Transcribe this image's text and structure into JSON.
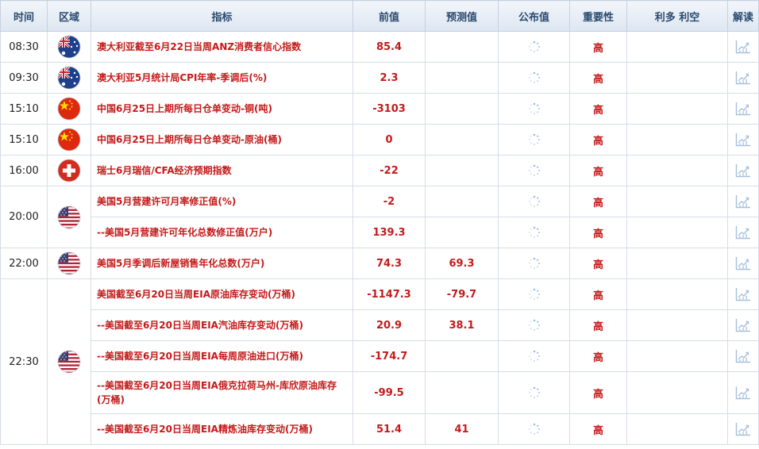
{
  "header": {
    "time": "时间",
    "region": "区域",
    "indicator": "指标",
    "previous": "前值",
    "forecast": "预测值",
    "actual": "公布值",
    "importance": "重要性",
    "impact": "利多 利空",
    "interpret": "解读"
  },
  "rows": {
    "r1": {
      "time": "08:30",
      "flag": "australia",
      "name": "澳大利亚截至6月22日当周ANZ消费者信心指数",
      "previous": "85.4",
      "forecast": "",
      "importance": "高"
    },
    "r2": {
      "time": "09:30",
      "flag": "australia",
      "name": "澳大利亚5月统计局CPI年率-季调后(%)",
      "previous": "2.3",
      "forecast": "",
      "importance": "高"
    },
    "r3": {
      "time": "15:10",
      "flag": "china",
      "name": "中国6月25日上期所每日仓单变动-铜(吨)",
      "previous": "-3103",
      "forecast": "",
      "importance": "高"
    },
    "r4": {
      "time": "15:10",
      "flag": "china",
      "name": "中国6月25日上期所每日仓单变动-原油(桶)",
      "previous": "0",
      "forecast": "",
      "importance": "高"
    },
    "r5": {
      "time": "16:00",
      "flag": "switzerland",
      "name": "瑞士6月瑞信/CFA经济预期指数",
      "previous": "-22",
      "forecast": "",
      "importance": "高"
    },
    "r6": {
      "time": "20:00",
      "flag": "usa",
      "name": "美国5月营建许可月率修正值(%)",
      "previous": "-2",
      "forecast": "",
      "importance": "高"
    },
    "r7": {
      "name": "--美国5月营建许可年化总数修正值(万户)",
      "previous": "139.3",
      "forecast": "",
      "importance": "高"
    },
    "r8": {
      "time": "22:00",
      "flag": "usa",
      "name": "美国5月季调后新屋销售年化总数(万户)",
      "previous": "74.3",
      "forecast": "69.3",
      "importance": "高"
    },
    "r9": {
      "time": "22:30",
      "flag": "usa",
      "name": "美国截至6月20日当周EIA原油库存变动(万桶)",
      "previous": "-1147.3",
      "forecast": "-79.7",
      "importance": "高"
    },
    "r10": {
      "name": "--美国截至6月20日当周EIA汽油库存变动(万桶)",
      "previous": "20.9",
      "forecast": "38.1",
      "importance": "高"
    },
    "r11": {
      "name": "--美国截至6月20日当周EIA每周原油进口(万桶)",
      "previous": "-174.7",
      "forecast": "",
      "importance": "高"
    },
    "r12": {
      "name": "--美国截至6月20日当周EIA俄克拉荷马州-库欣原油库存(万桶)",
      "previous": "-99.5",
      "forecast": "",
      "importance": "高"
    },
    "r13": {
      "name": "--美国截至6月20日当周EIA精炼油库存变动(万桶)",
      "previous": "51.4",
      "forecast": "41",
      "importance": "高"
    }
  },
  "colors": {
    "accent_red": "#c41a1a",
    "header_text": "#2a4a6e",
    "border": "#d6dde8"
  },
  "icons": {
    "actual": "loading-spinner-icon",
    "interpret": "chart-analysis-icon"
  }
}
